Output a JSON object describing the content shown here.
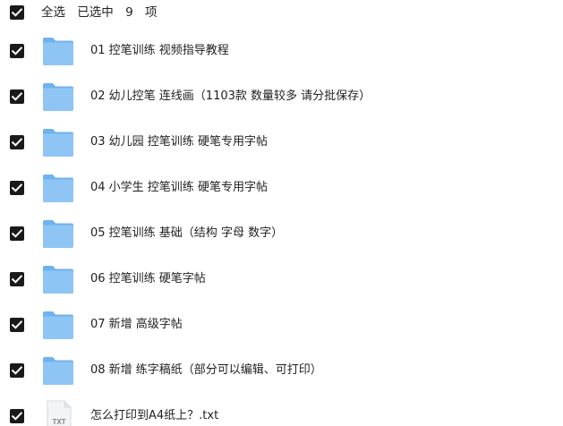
{
  "header": {
    "select_all": "全选",
    "selected_prefix": "已选中",
    "selected_count": "9",
    "selected_suffix": "项"
  },
  "items": [
    {
      "name": "01 控笔训练 视频指导教程",
      "type": "folder"
    },
    {
      "name": "02 幼儿控笔 连线画（1103款 数量较多 请分批保存）",
      "type": "folder"
    },
    {
      "name": "03 幼儿园 控笔训练 硬笔专用字帖",
      "type": "folder"
    },
    {
      "name": "04 小学生 控笔训练 硬笔专用字帖",
      "type": "folder"
    },
    {
      "name": "05 控笔训练 基础（结构 字母 数字）",
      "type": "folder"
    },
    {
      "name": "06 控笔训练 硬笔字帖",
      "type": "folder"
    },
    {
      "name": "07 新增 高级字帖",
      "type": "folder"
    },
    {
      "name": "08 新增 练字稿纸（部分可以编辑、可打印）",
      "type": "folder"
    },
    {
      "name": "怎么打印到A4纸上？.txt",
      "type": "txt",
      "badge": "TXT"
    }
  ],
  "colors": {
    "folder_front": "#8ec5f5",
    "folder_back": "#6fb2ee",
    "checkbox": "#1a1a1a"
  },
  "icons": {
    "folder": "folder-icon",
    "txt": "txt-file-icon",
    "check": "checkmark-icon"
  }
}
